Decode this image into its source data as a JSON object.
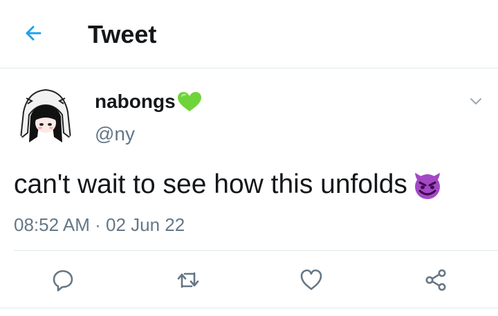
{
  "header": {
    "title": "Tweet",
    "back_icon": "arrow-left-icon",
    "accent_color": "#1da1f2"
  },
  "tweet": {
    "author_name": "nabongs",
    "author_name_emoji": "green-heart-emoji",
    "author_handle": "@ny",
    "text": "can't wait to see how this unfolds",
    "text_emoji": "smiling-devil-emoji",
    "time": "08:52 AM",
    "separator": "·",
    "date": "02 Jun 22"
  },
  "actions": [
    {
      "icon": "reply-icon"
    },
    {
      "icon": "retweet-icon"
    },
    {
      "icon": "like-icon"
    },
    {
      "icon": "share-icon"
    }
  ],
  "colors": {
    "text": "#14171a",
    "muted": "#657786",
    "divider": "#e1e8ed",
    "green_heart": "#6fd43a",
    "devil": "#a348c6"
  }
}
